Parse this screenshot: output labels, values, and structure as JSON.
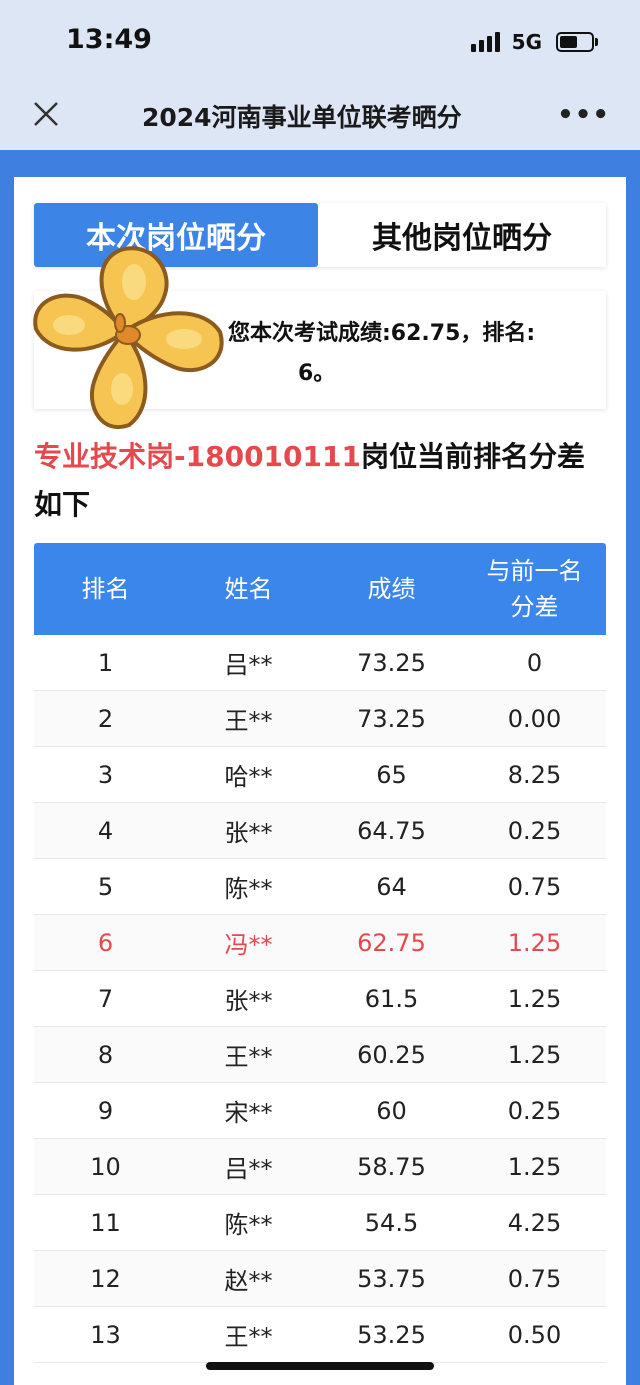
{
  "status_bar": {
    "time": "13:49",
    "network": "5G"
  },
  "nav": {
    "title": "2024河南事业单位联考晒分"
  },
  "tabs": [
    {
      "label": "本次岗位晒分",
      "active": true
    },
    {
      "label": "其他岗位晒分",
      "active": false
    }
  ],
  "score": {
    "line1": "您本次考试成绩:62.75，排名:",
    "line2": "6。"
  },
  "post": {
    "prefix": "专业技术岗-180010111",
    "suffix": "岗位当前排名分差如下"
  },
  "table": {
    "headers": [
      "排名",
      "姓名",
      "成绩",
      "与前一名分差"
    ],
    "rows": [
      {
        "rank": "1",
        "name": "吕**",
        "score": "73.25",
        "diff": "0"
      },
      {
        "rank": "2",
        "name": "王**",
        "score": "73.25",
        "diff": "0.00"
      },
      {
        "rank": "3",
        "name": "哈**",
        "score": "65",
        "diff": "8.25"
      },
      {
        "rank": "4",
        "name": "张**",
        "score": "64.75",
        "diff": "0.25"
      },
      {
        "rank": "5",
        "name": "陈**",
        "score": "64",
        "diff": "0.75"
      },
      {
        "rank": "6",
        "name": "冯**",
        "score": "62.75",
        "diff": "1.25"
      },
      {
        "rank": "7",
        "name": "张**",
        "score": "61.5",
        "diff": "1.25"
      },
      {
        "rank": "8",
        "name": "王**",
        "score": "60.25",
        "diff": "1.25"
      },
      {
        "rank": "9",
        "name": "宋**",
        "score": "60",
        "diff": "0.25"
      },
      {
        "rank": "10",
        "name": "吕**",
        "score": "58.75",
        "diff": "1.25"
      },
      {
        "rank": "11",
        "name": "陈**",
        "score": "54.5",
        "diff": "4.25"
      },
      {
        "rank": "12",
        "name": "赵**",
        "score": "53.75",
        "diff": "0.75"
      },
      {
        "rank": "13",
        "name": "王**",
        "score": "53.25",
        "diff": "0.50"
      }
    ]
  },
  "colors": {
    "accent": "#3c84e6",
    "highlight": "#e5484d"
  }
}
